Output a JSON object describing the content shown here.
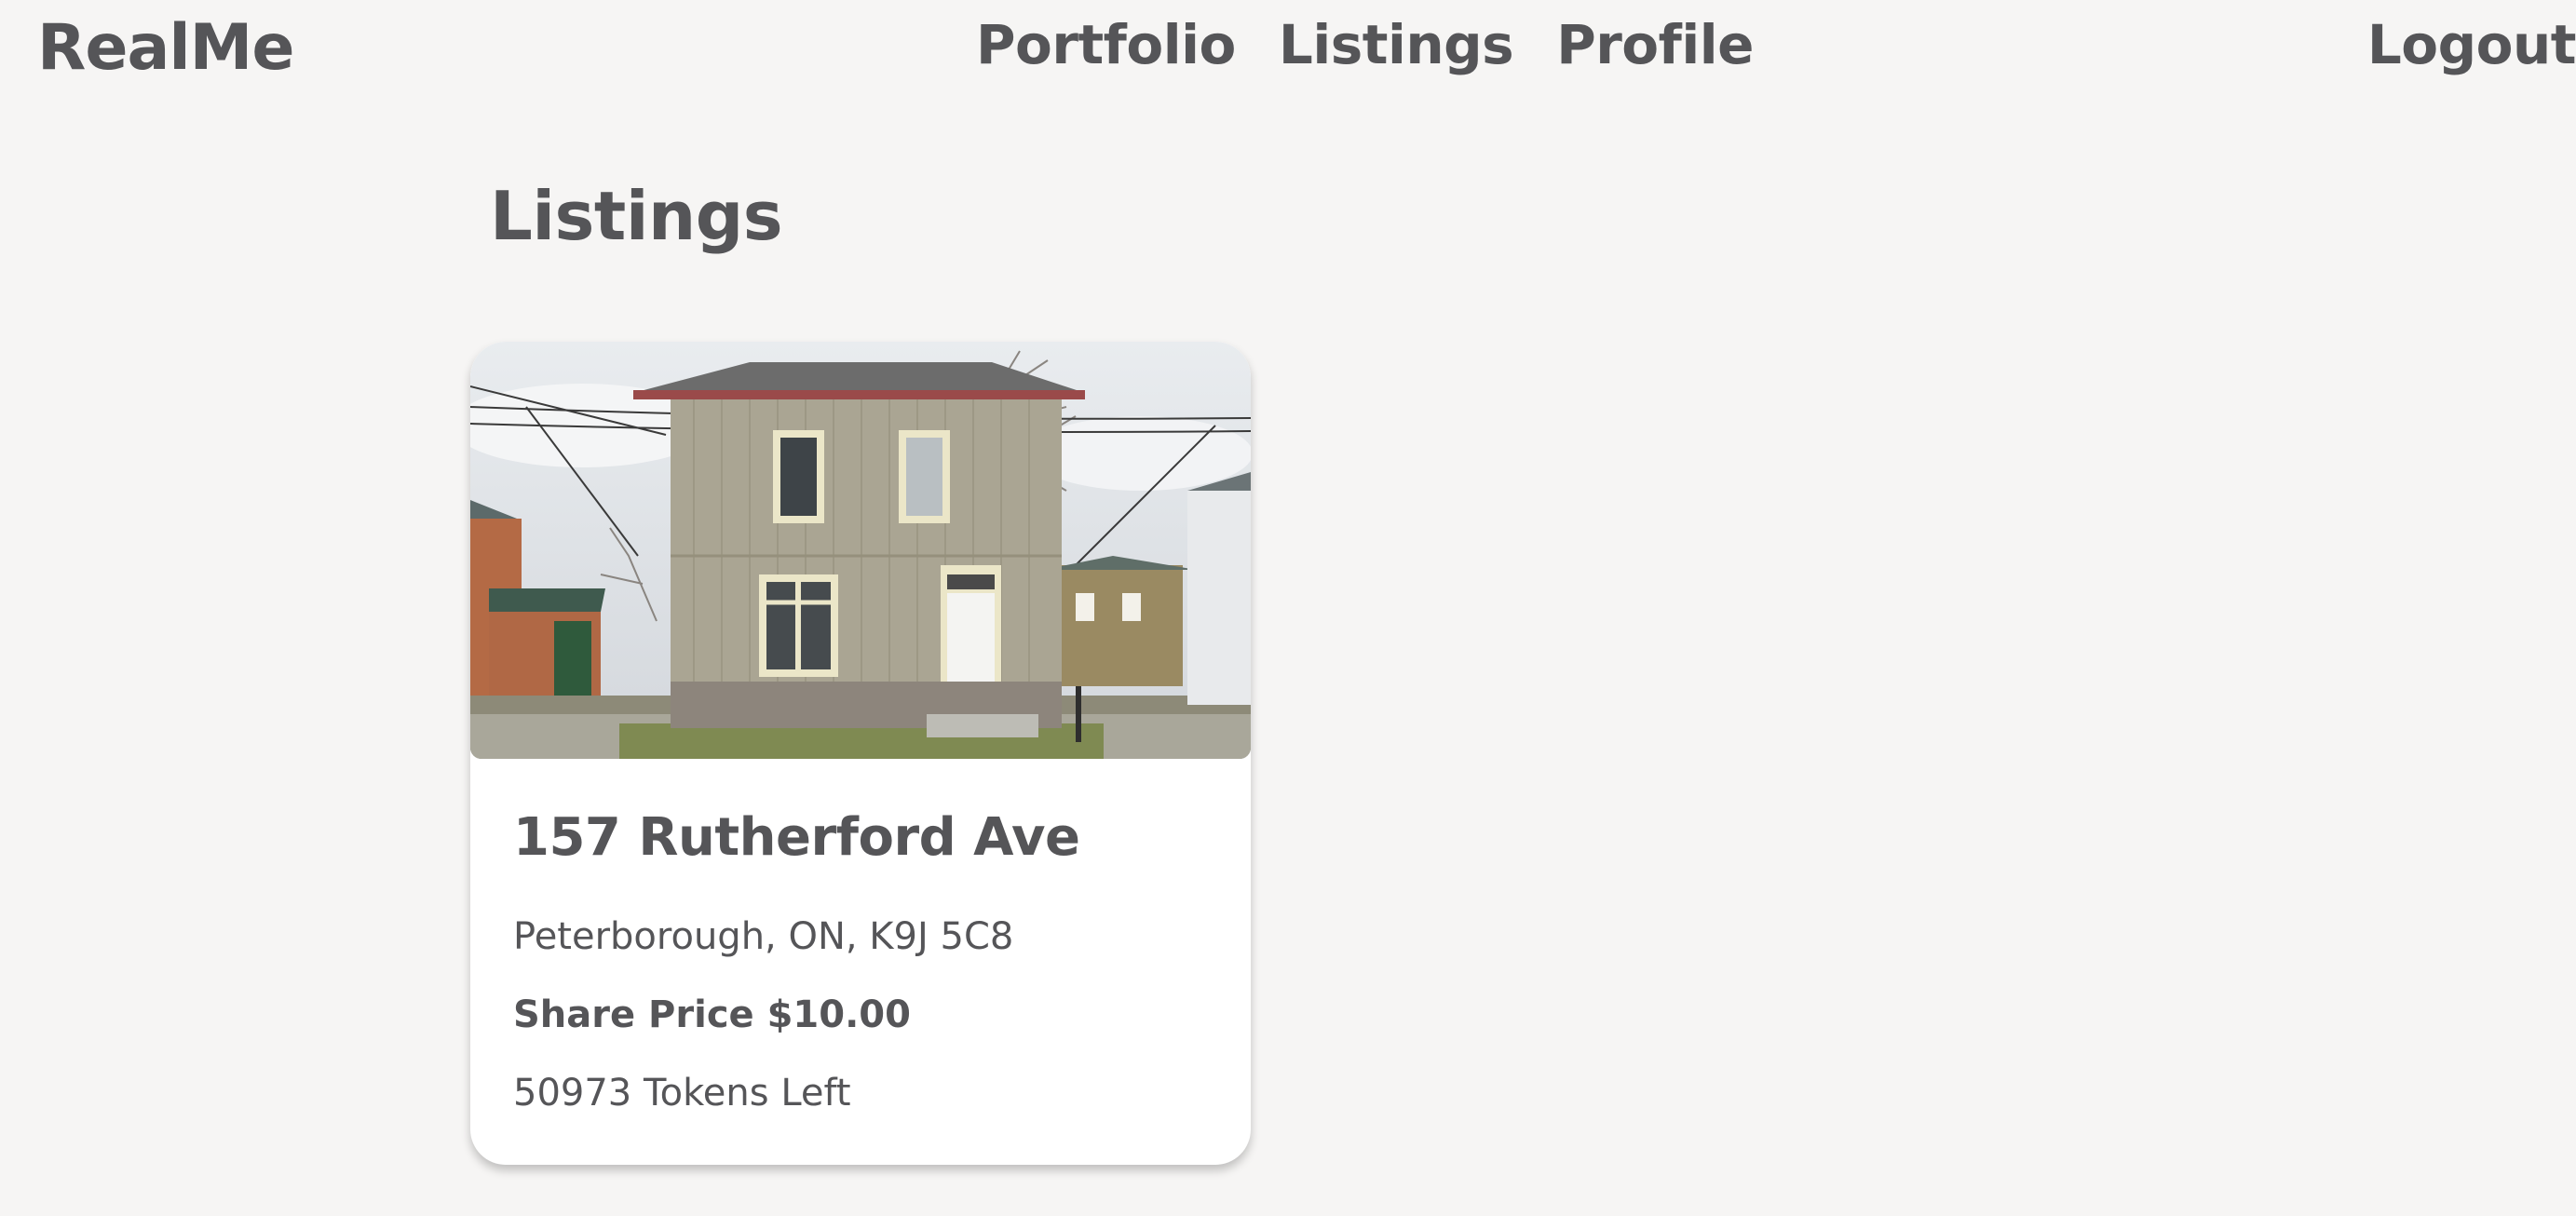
{
  "nav": {
    "brand": "RealMe",
    "links": [
      {
        "label": "Portfolio"
      },
      {
        "label": "Listings"
      },
      {
        "label": "Profile"
      }
    ],
    "logout": "Logout"
  },
  "page": {
    "title": "Listings"
  },
  "listings": [
    {
      "title": "157 Rutherford Ave",
      "address": "Peterborough, ON, K9J 5C8",
      "share_price": "Share Price $10.00",
      "tokens_left": "50973 Tokens Left",
      "image": "two-storey-house-photo"
    }
  ],
  "colors": {
    "background": "#f6f5f4",
    "text": "#555558",
    "card": "#ffffff"
  }
}
